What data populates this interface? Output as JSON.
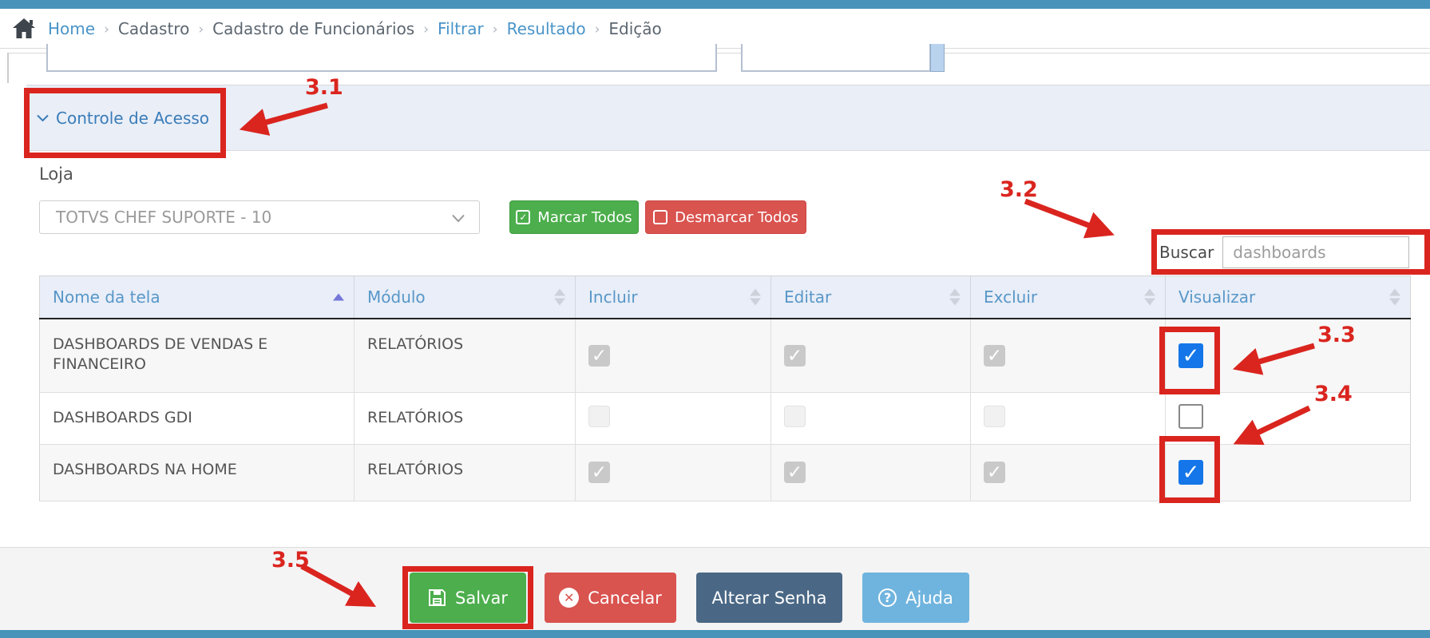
{
  "breadcrumb": {
    "separator": "›",
    "items": [
      {
        "label": "Home",
        "style": "link"
      },
      {
        "label": "Cadastro",
        "style": "plain"
      },
      {
        "label": "Cadastro de Funcionários",
        "style": "plain"
      },
      {
        "label": "Filtrar",
        "style": "link"
      },
      {
        "label": "Resultado",
        "style": "link"
      },
      {
        "label": "Edição",
        "style": "plain"
      }
    ]
  },
  "access_panel": {
    "title": "Controle de Acesso"
  },
  "store_select": {
    "label": "Loja",
    "value": "TOTVS CHEF SUPORTE - 10"
  },
  "bulk_buttons": {
    "mark_all": "Marcar Todos",
    "unmark_all": "Desmarcar Todos"
  },
  "search": {
    "label": "Buscar",
    "value": "dashboards"
  },
  "permissions_table": {
    "columns": [
      {
        "label": "Nome da tela",
        "sort": "asc"
      },
      {
        "label": "Módulo",
        "sort": "none"
      },
      {
        "label": "Incluir",
        "sort": "none"
      },
      {
        "label": "Editar",
        "sort": "none"
      },
      {
        "label": "Excluir",
        "sort": "none"
      },
      {
        "label": "Visualizar",
        "sort": "none"
      }
    ],
    "rows": [
      {
        "nome_da_tela": "DASHBOARDS DE VENDAS E FINANCEIRO",
        "modulo": "RELATÓRIOS",
        "incluir": {
          "checked": true,
          "disabled": true
        },
        "editar": {
          "checked": true,
          "disabled": true
        },
        "excluir": {
          "checked": true,
          "disabled": true
        },
        "visualizar": {
          "checked": true,
          "disabled": false
        }
      },
      {
        "nome_da_tela": "DASHBOARDS GDI",
        "modulo": "RELATÓRIOS",
        "incluir": {
          "checked": false,
          "disabled": true
        },
        "editar": {
          "checked": false,
          "disabled": true
        },
        "excluir": {
          "checked": false,
          "disabled": true
        },
        "visualizar": {
          "checked": false,
          "disabled": false
        }
      },
      {
        "nome_da_tela": "DASHBOARDS NA HOME",
        "modulo": "RELATÓRIOS",
        "incluir": {
          "checked": true,
          "disabled": true
        },
        "editar": {
          "checked": true,
          "disabled": true
        },
        "excluir": {
          "checked": true,
          "disabled": true
        },
        "visualizar": {
          "checked": true,
          "disabled": false
        }
      }
    ]
  },
  "footer": {
    "buttons": [
      {
        "label": "Salvar"
      },
      {
        "label": "Cancelar"
      },
      {
        "label": "Alterar Senha"
      },
      {
        "label": "Ajuda"
      }
    ]
  },
  "annotations": {
    "color": "#da251f",
    "labels": [
      "3.1",
      "3.2",
      "3.3",
      "3.4",
      "3.5"
    ]
  },
  "colors": {
    "accent_bar": "#4793ba",
    "panel_band": "#e9eef7",
    "link": "#4a94c8",
    "table_header_text": "#5897c8",
    "checkbox_active": "#1476e8",
    "success": "#4cae4c",
    "danger": "#d9534f",
    "slate": "#4a6885",
    "info": "#6fb4de"
  }
}
